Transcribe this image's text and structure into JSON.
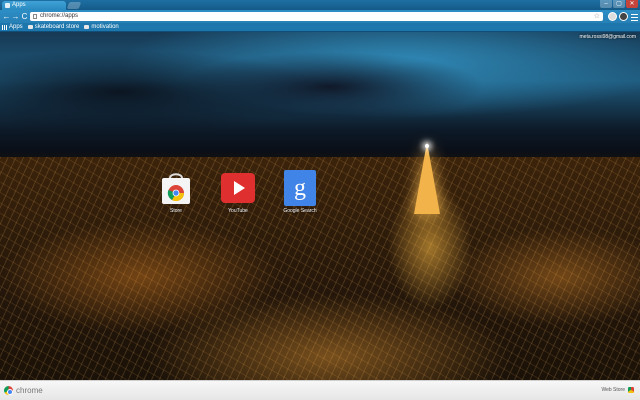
{
  "tab": {
    "title": "Apps"
  },
  "window": {
    "controls": [
      "–",
      "▢",
      "✕"
    ]
  },
  "toolbar": {
    "back": "←",
    "forward": "→",
    "reload": "C",
    "url": "chrome://apps",
    "star": "☆"
  },
  "bookmarks": [
    {
      "label": "Apps",
      "icon": "apps-grid-icon"
    },
    {
      "label": "skateboard store",
      "icon": "folder-icon"
    },
    {
      "label": "motivation",
      "icon": "folder-icon"
    }
  ],
  "account": {
    "email": "meta.rossi98@gmail.com"
  },
  "apps": [
    {
      "label": "Store",
      "icon": "chrome-web-store-icon"
    },
    {
      "label": "YouTube",
      "icon": "youtube-icon"
    },
    {
      "label": "Google Search",
      "icon": "google-search-icon"
    }
  ],
  "footer": {
    "brand": "chrome",
    "webstore_label": "Web Store"
  },
  "colors": {
    "tab_accent": "#2d8ec6",
    "wallpaper_glow": "#f2b44a"
  }
}
